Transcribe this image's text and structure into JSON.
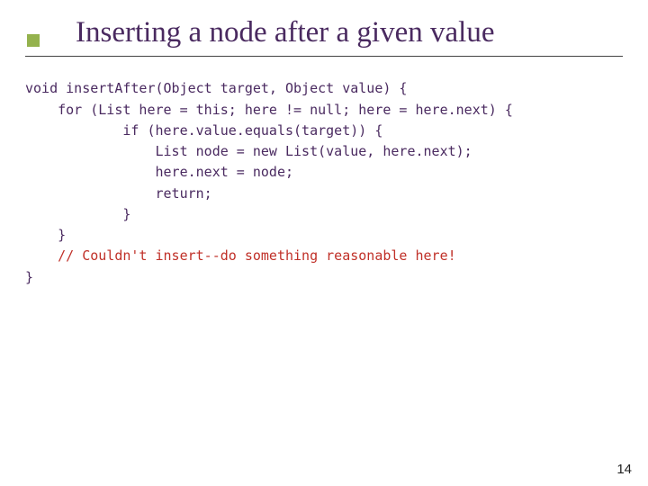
{
  "title": "Inserting a node after a given value",
  "code": {
    "l1": "void insertAfter(Object target, Object value) {",
    "l2": "    for (List here = this; here != null; here = here.next) {",
    "l3": "            if (here.value.equals(target)) {",
    "l4": "                List node = new List(value, here.next);",
    "l5": "                here.next = node;",
    "l6": "                return;",
    "l7": "            }",
    "l8": "    }",
    "l9": "    // Couldn't insert--do something reasonable here!",
    "l10": "}"
  },
  "slide_number": "14"
}
